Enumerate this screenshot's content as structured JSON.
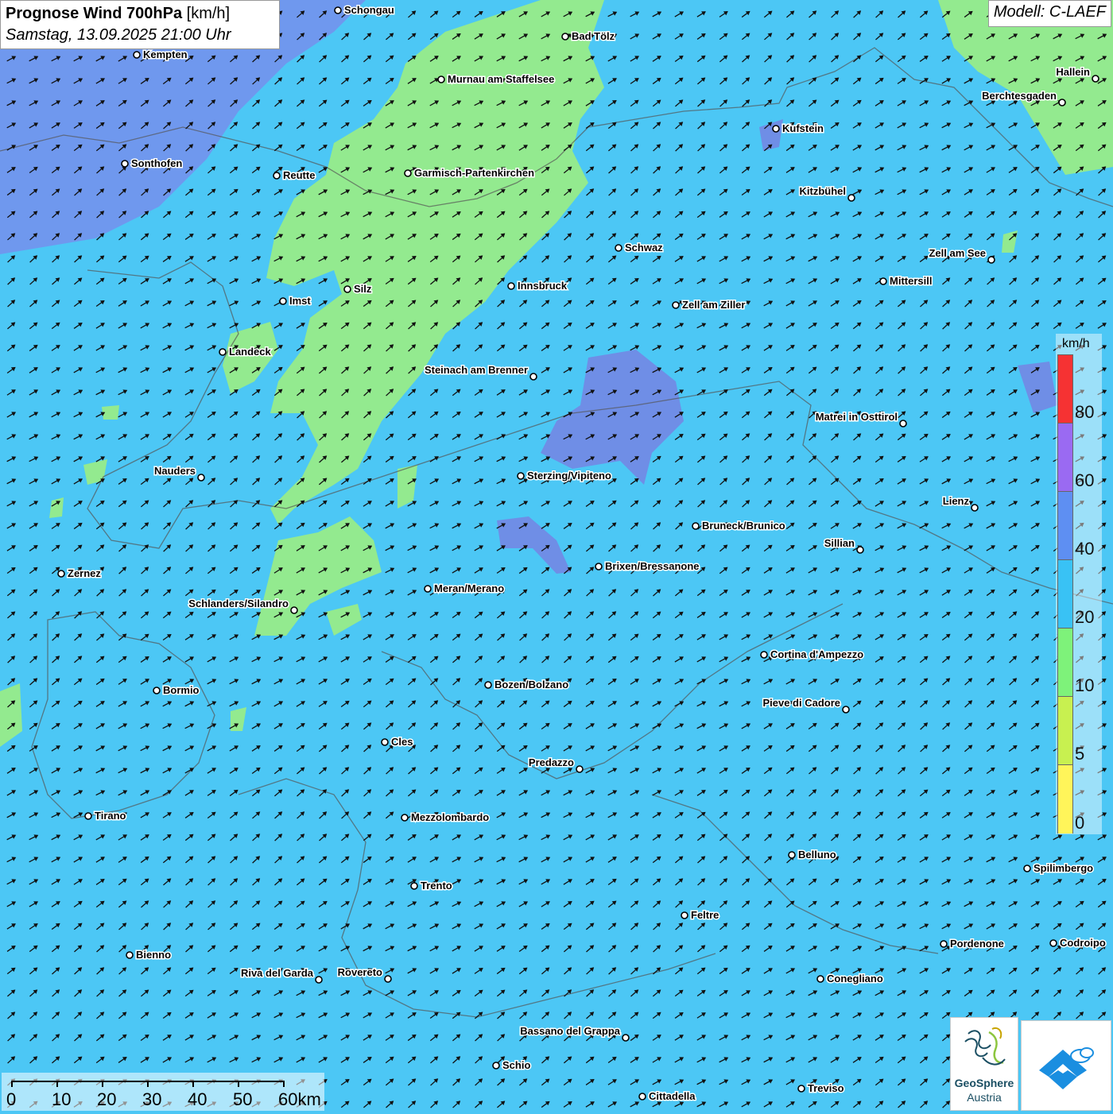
{
  "title": {
    "main": "Prognose Wind 700hPa",
    "unit": "[km/h]",
    "datetime": "Samstag, 13.09.2025 21:00 Uhr"
  },
  "model": "Modell: C-LAEF",
  "legend": {
    "unit": "km/h",
    "labels": [
      "80",
      "60",
      "40",
      "20",
      "10",
      "5",
      "0"
    ],
    "colors": [
      "#f63233",
      "#9a6af2",
      "#5e8ff2",
      "#39c2f5",
      "#7ef27a",
      "#c8f050",
      "#fff55a"
    ]
  },
  "scalebar": {
    "labels": [
      "0",
      "10",
      "20",
      "30",
      "40",
      "50",
      "60km"
    ]
  },
  "logos": {
    "geosphere_line1": "GeoSphere",
    "geosphere_line2": "Austria"
  },
  "colors": {
    "base_wind": "#4cc7f5",
    "light_wind": "#93ea8f",
    "strong_wind": "#6e8de8"
  },
  "wind_arrows": {
    "direction": "southwest wind, arrows pointing north-east",
    "color": "#111111"
  },
  "cities": [
    {
      "name": "Schongau"
    },
    {
      "name": "Bad Tölz"
    },
    {
      "name": "Kempten"
    },
    {
      "name": "Murnau am Staffelsee"
    },
    {
      "name": "Hallein"
    },
    {
      "name": "Berchtesgaden"
    },
    {
      "name": "Kufstein"
    },
    {
      "name": "Sonthofen"
    },
    {
      "name": "Reutte"
    },
    {
      "name": "Garmisch-Partenkirchen"
    },
    {
      "name": "Kitzbühel"
    },
    {
      "name": "Schwaz"
    },
    {
      "name": "Zell am See"
    },
    {
      "name": "Mittersill"
    },
    {
      "name": "Innsbruck"
    },
    {
      "name": "Silz"
    },
    {
      "name": "Imst"
    },
    {
      "name": "Zell am Ziller"
    },
    {
      "name": "Landeck"
    },
    {
      "name": "Steinach am Brenner"
    },
    {
      "name": "Matrei in Osttirol"
    },
    {
      "name": "Nauders"
    },
    {
      "name": "Sterzing/Vipiteno"
    },
    {
      "name": "Lienz"
    },
    {
      "name": "Bruneck/Brunico"
    },
    {
      "name": "Sillian"
    },
    {
      "name": "Zernez"
    },
    {
      "name": "Brixen/Bressanone"
    },
    {
      "name": "Meran/Merano"
    },
    {
      "name": "Schlanders/Silandro"
    },
    {
      "name": "Cortina d'Ampezzo"
    },
    {
      "name": "Bozen/Bolzano"
    },
    {
      "name": "Bormio"
    },
    {
      "name": "Pieve di Cadore"
    },
    {
      "name": "Cles"
    },
    {
      "name": "Predazzo"
    },
    {
      "name": "Tirano"
    },
    {
      "name": "Mezzolombardo"
    },
    {
      "name": "Belluno"
    },
    {
      "name": "Spilimbergo"
    },
    {
      "name": "Trento"
    },
    {
      "name": "Feltre"
    },
    {
      "name": "Pordenone"
    },
    {
      "name": "Codroipo"
    },
    {
      "name": "Bienno"
    },
    {
      "name": "Riva del Garda"
    },
    {
      "name": "Rovereto"
    },
    {
      "name": "Conegliano"
    },
    {
      "name": "Bassano del Grappa"
    },
    {
      "name": "Schio"
    },
    {
      "name": "Treviso"
    },
    {
      "name": "Cittadella"
    }
  ]
}
